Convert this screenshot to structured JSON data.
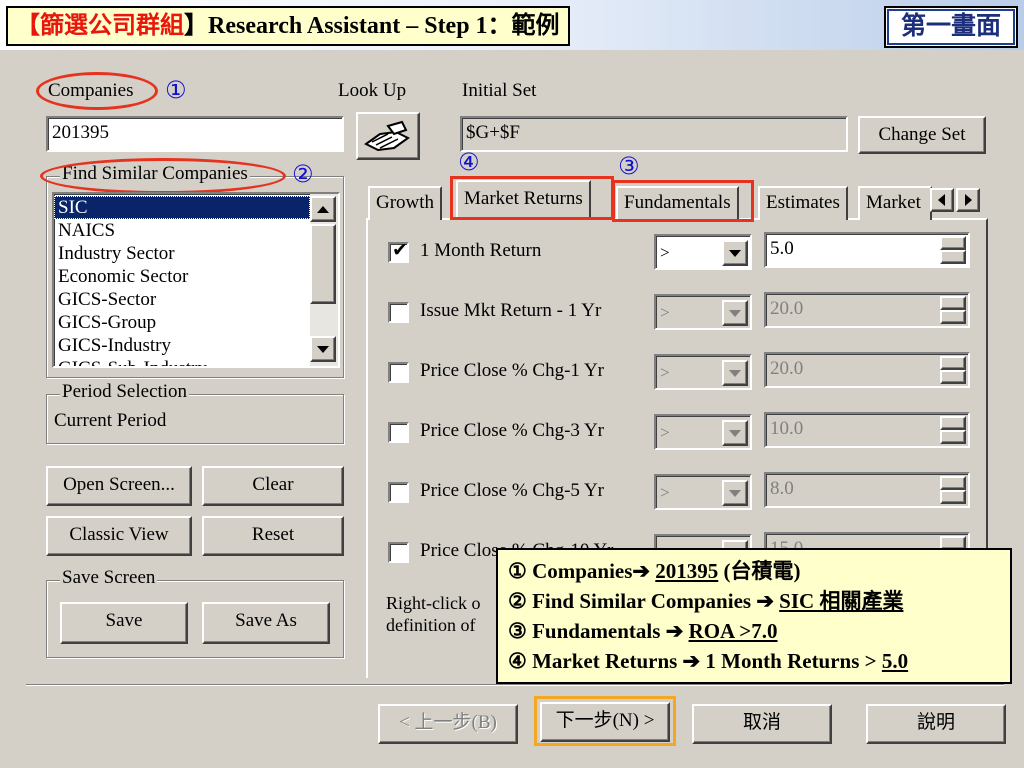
{
  "slide": {
    "title_prefix": "【",
    "title_cn": "篩選公司群組",
    "title_suffix": "】Research Assistant – Step 1：範例",
    "screen_tag": "第一畫面"
  },
  "markers": {
    "m1": "①",
    "m2": "②",
    "m3": "③",
    "m4": "④"
  },
  "companies": {
    "label": "Companies",
    "value": "201395"
  },
  "lookup": {
    "label": "Look Up"
  },
  "initial_set": {
    "label": "Initial Set",
    "value": "$G+$F",
    "change_button": "Change Set"
  },
  "find_similar": {
    "label": "Find Similar Companies",
    "items": [
      "SIC",
      "NAICS",
      "Industry Sector",
      "Economic Sector",
      "GICS-Sector",
      "GICS-Group",
      "GICS-Industry",
      "GICS-Sub-Industry"
    ],
    "selected": "SIC"
  },
  "period": {
    "label": "Period Selection",
    "value": "Current Period"
  },
  "buttons": {
    "open_screen": "Open Screen...",
    "clear": "Clear",
    "classic_view": "Classic View",
    "reset": "Reset"
  },
  "save_screen": {
    "label": "Save Screen",
    "save": "Save",
    "save_as": "Save As"
  },
  "tabs": [
    "Growth",
    "Market Returns",
    "Fundamentals",
    "Estimates",
    "Market"
  ],
  "active_tab": "Market Returns",
  "criteria": [
    {
      "label": "1 Month Return",
      "checked": true,
      "operator": ">",
      "value": "5.0",
      "enabled": true
    },
    {
      "label": "Issue Mkt Return - 1 Yr",
      "checked": false,
      "operator": ">",
      "value": "20.0",
      "enabled": false
    },
    {
      "label": "Price Close % Chg-1 Yr",
      "checked": false,
      "operator": ">",
      "value": "20.0",
      "enabled": false
    },
    {
      "label": "Price Close % Chg-3 Yr",
      "checked": false,
      "operator": ">",
      "value": "10.0",
      "enabled": false
    },
    {
      "label": "Price Close % Chg-5 Yr",
      "checked": false,
      "operator": ">",
      "value": "8.0",
      "enabled": false
    },
    {
      "label": "Price Close % Chg-10 Yr",
      "checked": false,
      "operator": ">",
      "value": "15.0",
      "enabled": false
    }
  ],
  "hint_text": {
    "line1": "Right-click o",
    "line2": "definition of"
  },
  "wizard": {
    "back": "< 上一步(B)",
    "next": "下一步(N) >",
    "cancel": "取消",
    "help": "說明"
  },
  "note": {
    "l1_a": "① Companies",
    "l1_arrow": "➔",
    "l1_val": "201395",
    "l1_rest": "(台積電)",
    "l2_a": "② Find Similar Companies",
    "l2_arrow": "➔",
    "l2_val": "SIC 相關產業",
    "l3_a": "③ Fundamentals",
    "l3_arrow": "➔",
    "l3_val": "ROA >7.0",
    "l4_a": "④ Market Returns",
    "l4_arrow": "➔",
    "l4_rest": "1 Month Returns >",
    "l4_val": "5.0"
  },
  "colors": {
    "annotation_red": "#e5331f",
    "highlight_orange": "#f5a623",
    "selection_blue": "#0a246a",
    "note_bg": "#ffffcc"
  }
}
